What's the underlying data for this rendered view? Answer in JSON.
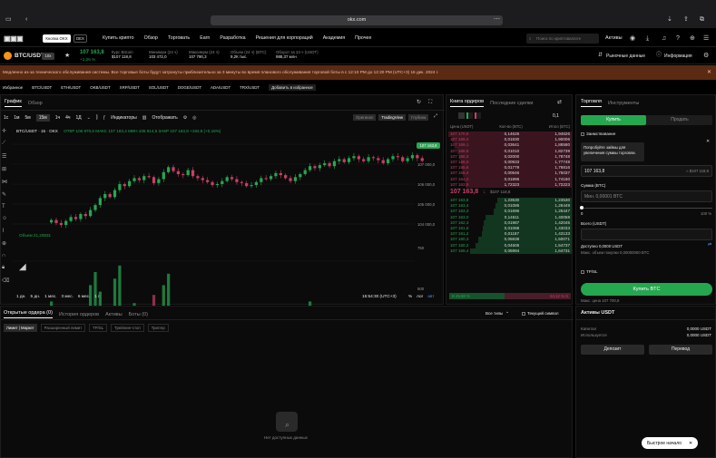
{
  "browser": {
    "url": "okx.com"
  },
  "nav": {
    "buttons": [
      "Кнопка OKX",
      "DEX"
    ],
    "items": [
      "Купить крипто",
      "Обзор",
      "Торговать",
      "Earn",
      "Разработка",
      "Решения для корпораций",
      "Академия",
      "Прочее"
    ],
    "search_placeholder": "Поиск по криптовалюте",
    "assets": "Активы"
  },
  "ticker": {
    "pair": "BTC/USDT",
    "leverage": "10x",
    "price": "107 163,8",
    "change": "+1,26 %",
    "stats": [
      {
        "label": "Курс Bitcoin",
        "value": "$107 118,8"
      },
      {
        "label": "Минимум (24 ч)",
        "value": "103 472,0"
      },
      {
        "label": "Максимум (24 ч)",
        "value": "107 790,3"
      },
      {
        "label": "Объем (24 ч) (BTC)",
        "value": "9,2К тыс."
      },
      {
        "label": "Оборот за 24 ч (USDT)",
        "value": "988,37 млн"
      }
    ],
    "market_data": "Рыночные данные",
    "info": "Информация"
  },
  "banner": {
    "text": "Медленно из-за технического обслуживания системы. Все торговые боты будут затронуты приблизительно за 3 минуты во время планового обслуживания торговой боты в с 12:10 PM до 12:20 PM (UTC+3) 16 дек. 2024 г."
  },
  "pairs": [
    "Избранное",
    "BTC/USDT",
    "ETH/USDT",
    "OKB/USDT",
    "XRP/USDT",
    "SOL/USDT",
    "DOGE/USDT",
    "ADA/USDT",
    "TRX/USDT",
    "Добавить в избранное"
  ],
  "chart": {
    "tabs": [
      "График",
      "Обзор"
    ],
    "intervals": [
      "1с",
      "1м",
      "5м",
      "15м",
      "1ч",
      "4ч",
      "1Д"
    ],
    "indicators": "Индикаторы",
    "display": "Отображать",
    "views": [
      "Оригинал",
      "TradingView",
      "Глубина"
    ],
    "legend_pair": "BTC/USDT · 15 · OKX",
    "ohlc": "ОТКР 106 970,6  МАКС 107 183,4  МИН 106 914,5  ЗАКР 107 163,8 +193,8 (+0,18%)",
    "volume_label": "Объем  21,20831",
    "price_tag": "107 163,8",
    "ranges": [
      "1 дн.",
      "5 дн.",
      "1 мес.",
      "3 мес.",
      "6 мес.",
      "1 г."
    ],
    "clock": "15:54:30 (UTC+3)",
    "scale_options": [
      "%",
      "лог",
      "авт"
    ]
  },
  "chart_data": {
    "type": "candlestick",
    "ylim": [
      103500,
      108500
    ],
    "yticks": [
      "108 000,0",
      "107 000,0",
      "106 000,0",
      "105 000,0",
      "104 000,0"
    ],
    "vticks": [
      "750",
      "500",
      "250"
    ],
    "xticks": [
      "18",
      "06:00",
      "12:00",
      "18:00",
      "17",
      "06:00",
      "12:00"
    ],
    "close": [
      104200,
      104050,
      103950,
      104150,
      104350,
      104250,
      104500,
      104400,
      104700,
      104950,
      105300,
      105500,
      105350,
      105700,
      106000,
      105900,
      106150,
      106300,
      106200,
      106400,
      106350,
      106050,
      106250,
      106600,
      106850,
      106650,
      106500,
      106450,
      106700,
      106400,
      106300,
      106200,
      106100,
      105950,
      106000,
      106150,
      106350,
      106250,
      106100,
      106050,
      105900,
      105950,
      106100,
      106300,
      106250,
      106400,
      106550,
      106450,
      106300,
      106150,
      106350,
      106500,
      106700,
      106900,
      106800,
      106950,
      107050,
      106900,
      107150,
      107250,
      107100,
      107300,
      107400,
      107250,
      107150,
      107350,
      107300,
      107200,
      107050,
      107250,
      107400,
      107350,
      107150,
      107300,
      107450,
      107300,
      107163.8
    ],
    "volume": [
      420,
      300,
      260,
      240,
      310,
      220,
      380,
      260,
      520,
      600,
      480,
      350,
      310,
      560,
      640,
      290,
      330,
      410,
      250,
      300,
      210,
      460,
      270,
      520,
      590,
      330,
      210,
      200,
      300,
      340,
      220,
      200,
      260,
      300,
      210,
      230,
      280,
      210,
      180,
      220,
      250,
      170,
      160,
      230,
      190,
      200,
      250,
      300,
      210,
      190,
      230,
      280,
      340,
      420,
      250,
      310,
      350,
      260,
      380,
      300,
      240,
      330,
      360,
      250,
      210,
      260,
      230,
      200,
      240,
      250,
      290,
      220,
      200,
      250,
      270,
      210,
      230
    ]
  },
  "orderbook": {
    "tabs": [
      "Книга ордеров",
      "Последние сделки"
    ],
    "precision": "0,1",
    "headers": [
      "Цена (USDT)",
      "Кол-во (BTC)",
      "Итого (BTC)"
    ],
    "asks": [
      [
        "107 170,6",
        "0,14626",
        "1,94626"
      ],
      [
        "107 169,2",
        "0,01830",
        "1,90006"
      ],
      [
        "107 169,1",
        "0,03641",
        "1,88580"
      ],
      [
        "107 168,8",
        "0,01010",
        "1,82739"
      ],
      [
        "107 168,3",
        "0,02000",
        "1,78748"
      ],
      [
        "107 166,0",
        "0,00933",
        "1,77749"
      ],
      [
        "107 165,6",
        "0,01779",
        "1,76816"
      ],
      [
        "107 165,4",
        "0,00646",
        "1,75037"
      ],
      [
        "107 164,2",
        "0,01896",
        "1,74160"
      ],
      [
        "107 163,9",
        "1,72323",
        "1,72223"
      ]
    ],
    "ask_fill": [
      1,
      0.97,
      0.95,
      0.93,
      0.91,
      0.9,
      0.89,
      0.88,
      0.87,
      0.86
    ],
    "mid_price": "107 163,8",
    "mid_usd": "$107 118,8",
    "bids": [
      [
        "107 163,8",
        "1,23530",
        "1,23530"
      ],
      [
        "107 163,4",
        "0,01086",
        "1,26449"
      ],
      [
        "107 163,3",
        "0,01696",
        "1,26447"
      ],
      [
        "107 163,0",
        "0,14611",
        "1,40058"
      ],
      [
        "107 162,3",
        "0,01987",
        "1,42045"
      ],
      [
        "107 161,6",
        "0,01088",
        "1,43033"
      ],
      [
        "107 161,2",
        "0,01187",
        "1,43133"
      ],
      [
        "107 160,3",
        "0,05838",
        "1,50071"
      ],
      [
        "107 160,2",
        "0,04606",
        "1,54737"
      ],
      [
        "107 159,4",
        "0,05994",
        "1,64731"
      ]
    ],
    "bid_fill": [
      0.6,
      0.62,
      0.63,
      0.7,
      0.71,
      0.72,
      0.73,
      0.76,
      0.78,
      0.82
    ],
    "buy_pct": "B 45,88 %",
    "sell_pct": "54,12 % S",
    "buy_ratio": 0.4588
  },
  "trade": {
    "tabs": [
      "Торговля",
      "Инструменты"
    ],
    "buy": "Купить",
    "sell": "Продать",
    "borrow": "Заимствование",
    "hint": "Попробуйте займы для увеличения суммы торговли.",
    "price_value": "107 163,8",
    "price_hint": "≈ $107 118,8",
    "amount_label": "Сумма (BTC)",
    "amount_placeholder": "Мин. 0,00001 BTC",
    "slider_min": "0",
    "slider_max": "100 %",
    "total_label": "Всего (USDT)",
    "available": "Доступно 0,0000 USDT",
    "max_buy": "Макс. объем покупки 0,00000000 BTC",
    "tpsl": "TP/SL",
    "submit": "Купить BTC",
    "max_price": "Макс. цена 107 700,8"
  },
  "orders": {
    "tabs": [
      "Открытые ордера (0)",
      "История ордеров",
      "Активы",
      "Боты (0)"
    ],
    "filter": "Все типы",
    "current_symbol": "Текущий символ",
    "subtabs": [
      "Лимит | Маркет",
      "Расширенный лимит",
      "TP/SL",
      "Трейлинг-стоп",
      "Триггер"
    ],
    "empty": "Нет доступных данных"
  },
  "assets": {
    "title": "Активы USDT",
    "rows": [
      [
        "Капитал",
        "0,0000 USDT"
      ],
      [
        "Используется",
        "0,0000 USDT"
      ]
    ],
    "deposit": "Депозит",
    "transfer": "Перевод",
    "quick_start": "Быстрое начало"
  },
  "colors": {
    "up": "#25a750",
    "down": "#ca3f64",
    "accent": "#25a750",
    "banner": "#5a2a12"
  }
}
